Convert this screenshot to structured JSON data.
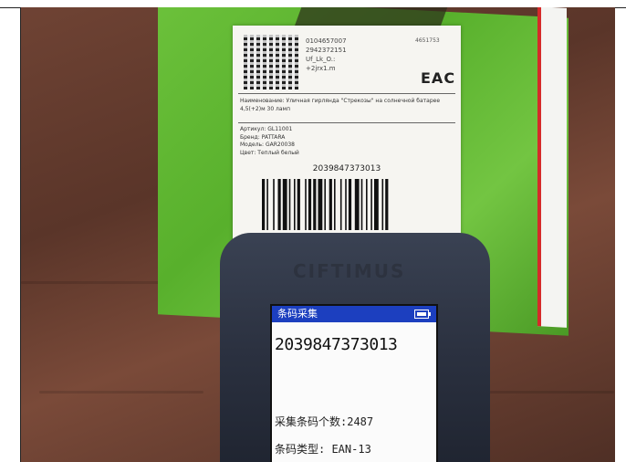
{
  "label": {
    "code_lines": [
      "0104657007",
      "2942372151",
      "Uf_Lk_O.:",
      "+2jrx1.m"
    ],
    "side_code": "4651753",
    "eac": "EAC",
    "name": "Наименование: Уличная гирлянда \"Стрекозы\" на солнечной батарее 4,5(+2)м 30 ламп",
    "props": [
      "Артикул: GL11001",
      "Бренд: PATTARA",
      "Модель: GAR20038",
      "Цвет: Теплый белый"
    ],
    "barcode_number": "2039847373013"
  },
  "scanner": {
    "brand": "CIFTIMUS",
    "screen_title": "条码采集",
    "scanned_value": "2039847373013",
    "count_line": "采集条码个数:2487",
    "type_line": "条码类型: EAN-13"
  }
}
